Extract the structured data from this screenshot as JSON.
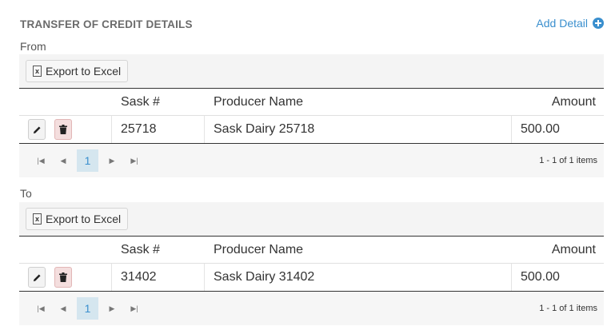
{
  "header": {
    "title": "TRANSFER OF CREDIT DETAILS",
    "add_detail_label": "Add Detail"
  },
  "sections": [
    {
      "label": "From",
      "export_label": "Export to Excel",
      "columns": {
        "sask": "Sask #",
        "producer": "Producer Name",
        "amount": "Amount"
      },
      "rows": [
        {
          "sask": "25718",
          "producer": "Sask Dairy 25718",
          "amount": "500.00"
        }
      ],
      "pager": {
        "current_page": "1",
        "info": "1 - 1 of 1 items"
      }
    },
    {
      "label": "To",
      "export_label": "Export to Excel",
      "columns": {
        "sask": "Sask #",
        "producer": "Producer Name",
        "amount": "Amount"
      },
      "rows": [
        {
          "sask": "31402",
          "producer": "Sask Dairy 31402",
          "amount": "500.00"
        }
      ],
      "pager": {
        "current_page": "1",
        "info": "1 - 1 of 1 items"
      }
    }
  ],
  "colors": {
    "accent": "#3a8fce",
    "heading": "#6b6b6b",
    "delete_bg": "#f4dede",
    "page_bg": "#d5e6ef"
  },
  "icons": [
    "plus-circle-icon",
    "excel-icon",
    "pencil-icon",
    "trash-icon",
    "first-page-icon",
    "prev-page-icon",
    "next-page-icon",
    "last-page-icon"
  ]
}
